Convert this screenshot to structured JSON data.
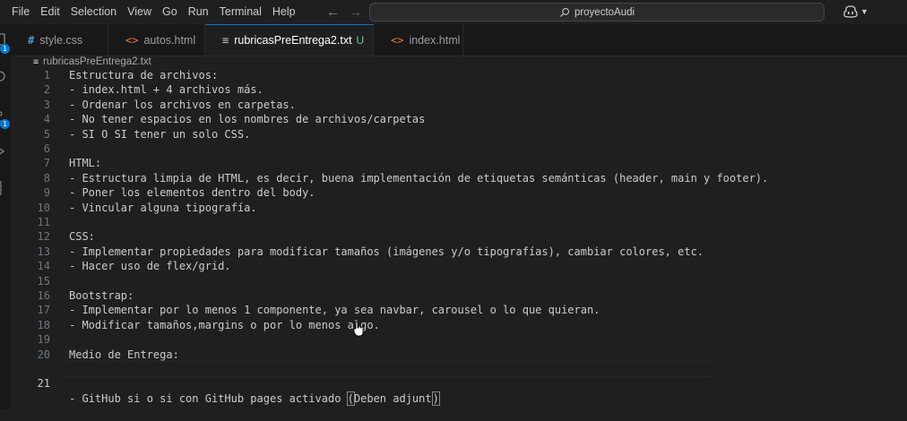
{
  "menu": [
    "File",
    "Edit",
    "Selection",
    "View",
    "Go",
    "Run",
    "Terminal",
    "Help"
  ],
  "nav": {
    "back_icon": "arrow-left-icon",
    "forward_icon": "arrow-right-icon"
  },
  "search": {
    "text": "proyectoAudi",
    "icon": "search-icon"
  },
  "copilot": {
    "icon": "copilot-icon"
  },
  "activity": {
    "explorer_badge": "1",
    "scm_badge": "1"
  },
  "tabs": [
    {
      "icon": "#",
      "label": "style.css",
      "type": "css"
    },
    {
      "icon": "<>",
      "label": "autos.html",
      "type": "html"
    },
    {
      "icon": "≡",
      "label": "rubricasPreEntrega2.txt",
      "type": "txt",
      "status": "U",
      "active": true
    },
    {
      "icon": "<>",
      "label": "index.html",
      "type": "html"
    }
  ],
  "breadcrumb": {
    "icon": "≡",
    "file": "rubricasPreEntrega2.txt"
  },
  "editor": {
    "current_line": 21,
    "lines": [
      "Estructura de archivos:",
      "- index.html + 4 archivos más.",
      "- Ordenar los archivos en carpetas.",
      "- No tener espacios en los nombres de archivos/carpetas",
      "- SI O SI tener un solo CSS.",
      "",
      "HTML:",
      "- Estructura limpia de HTML, es decir, buena implementación de etiquetas semánticas (header, main y footer).",
      "- Poner los elementos dentro del body.",
      "- Vincular alguna tipografía.",
      "",
      "CSS:",
      "- Implementar propiedades para modificar tamaños (imágenes y/o tipografías), cambiar colores, etc.",
      "- Hacer uso de flex/grid.",
      "",
      "Bootstrap:",
      "- Implementar por lo menos 1 componente, ya sea navbar, carousel o lo que quieran.",
      "- Modificar tamaños,margins o por lo menos algo.",
      "",
      "Medio de Entrega:",
      "- GitHub si o si con GitHub pages activado (Deben adjunt)"
    ],
    "last_line_prefix": "- GitHub si o si con GitHub pages activado ",
    "last_line_open": "(",
    "last_line_middle": "Deben adjunt",
    "last_line_close": ")"
  }
}
